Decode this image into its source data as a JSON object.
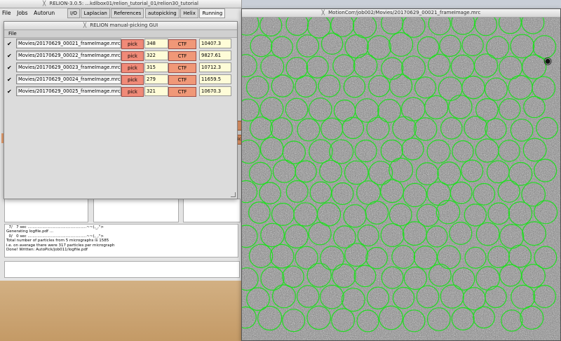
{
  "main_window": {
    "title": "RELION-3.0.5: ...kdlbox01/relion_tutorial_01/relion30_tutorial",
    "menu": [
      "File",
      "Jobs",
      "Autorun"
    ],
    "tabs": [
      "I/O",
      "Laplacian",
      "References",
      "autopicking",
      "Helix",
      "Running"
    ],
    "side_labels": [
      "C",
      "pic"
    ],
    "log_lines": [
      "  7/   7 sec ................................................~~(,_,\">",
      "Generating logfile.pdf ...",
      "  0/   0 sec ................................................~~(,_,\">",
      "Total number of particles from 5 micrographs is 1585",
      "i.e. on average there were 317 particles per micrograph",
      "Done! Written: AutoPick/job011/logfile.pdf"
    ]
  },
  "picker_window": {
    "title": "RELION manual-picking GUI",
    "menu_file": "File",
    "rows": [
      {
        "file": "Movies/20170629_00021_frameImage.mrc",
        "pick": "pick",
        "count": "348",
        "ctf": "CTF",
        "ctf_value": "10407.3"
      },
      {
        "file": "Movies/20170629_00022_frameImage.mrc",
        "pick": "pick",
        "count": "322",
        "ctf": "CTF",
        "ctf_value": "9827.61"
      },
      {
        "file": "Movies/20170629_00023_frameImage.mrc",
        "pick": "pick",
        "count": "315",
        "ctf": "CTF",
        "ctf_value": "10712.3"
      },
      {
        "file": "Movies/20170629_00024_frameImage.mrc",
        "pick": "pick",
        "count": "279",
        "ctf": "CTF",
        "ctf_value": "11659.5"
      },
      {
        "file": "Movies/20170629_00025_frameImage.mrc",
        "pick": "pick",
        "count": "321",
        "ctf": "CTF",
        "ctf_value": "10670.3"
      }
    ]
  },
  "micrograph_window": {
    "title": "MotionCorr/job002/Movies/20170629_00021_frameImage.mrc",
    "circle_color": "#22dd22"
  }
}
